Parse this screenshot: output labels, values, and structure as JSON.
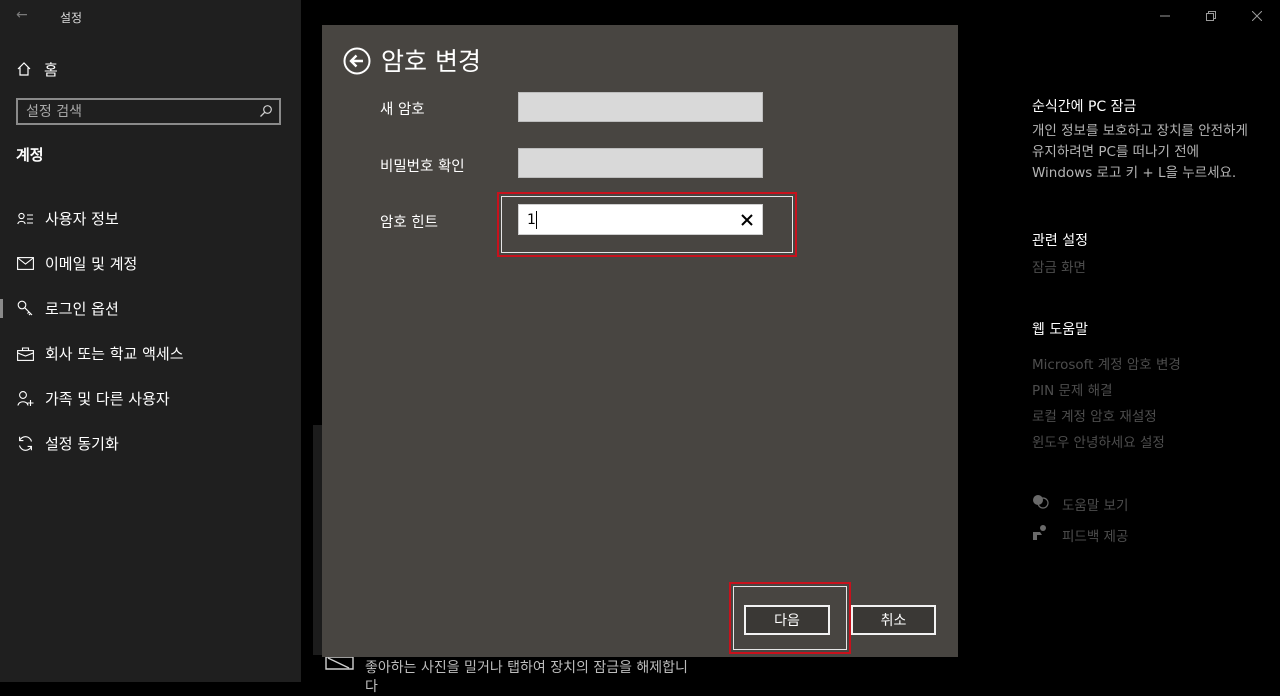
{
  "window": {
    "title": "설정"
  },
  "sidebar": {
    "home_label": "홈",
    "search_placeholder": "설정 검색",
    "section_title": "계정",
    "items": [
      {
        "label": "사용자 정보",
        "icon": "user-info-icon"
      },
      {
        "label": "이메일 및 계정",
        "icon": "mail-icon"
      },
      {
        "label": "로그인 옵션",
        "icon": "key-icon"
      },
      {
        "label": "회사 또는 학교 액세스",
        "icon": "briefcase-icon"
      },
      {
        "label": "가족 및 다른 사용자",
        "icon": "person-add-icon"
      },
      {
        "label": "설정 동기화",
        "icon": "sync-icon"
      }
    ],
    "active_index": 2
  },
  "right_panel": {
    "lock_title": "순식간에 PC 잠금",
    "lock_desc": "개인 정보를 보호하고 장치를 안전하게 유지하려면 PC를 떠나기 전에 Windows 로고 키 + L을 누르세요.",
    "related_title": "관련 설정",
    "related_links": [
      "잠금 화면"
    ],
    "web_help_title": "웹 도움말",
    "web_help_links": [
      "Microsoft 계정 암호 변경",
      "PIN 문제 해결",
      "로컬 계정 암호 재설정",
      "윈도우 안녕하세요 설정"
    ],
    "help_label": "도움말 보기",
    "feedback_label": "피드백 제공"
  },
  "background": {
    "peek_line1": "좋아하는 사진을 밀거나 탭하여 장치의 잠금을 해제합니",
    "peek_line2": "다"
  },
  "dialog": {
    "title": "암호 변경",
    "new_password_label": "새 암호",
    "confirm_label": "비밀번호 확인",
    "hint_label": "암호 힌트",
    "hint_value": "1",
    "next_button": "다음",
    "cancel_button": "취소"
  },
  "colors": {
    "dialog_bg": "#484541",
    "highlight": "#c8111c",
    "sidebar_bg": "#1f1f1f"
  }
}
